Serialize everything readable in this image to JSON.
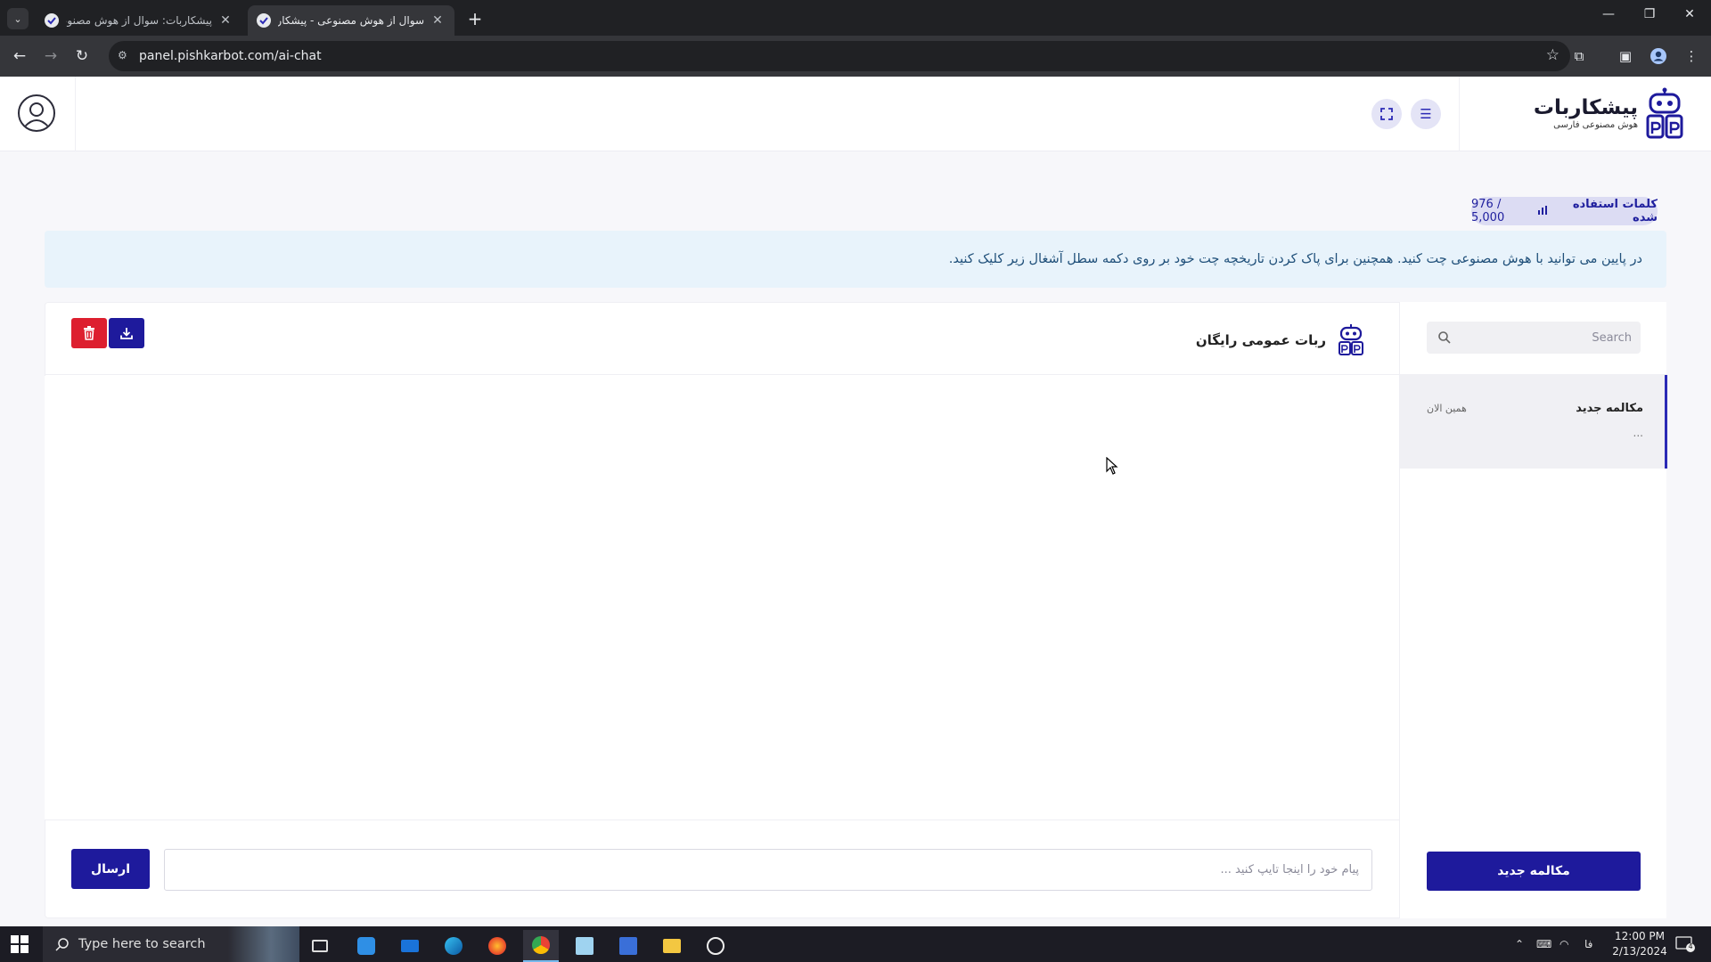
{
  "browser": {
    "tabs": [
      {
        "title": "پیشکاربات: سوال از هوش مصنوعی",
        "active": false
      },
      {
        "title": "سوال از هوش مصنوعی - پیشکاربات",
        "active": true
      }
    ],
    "url": "panel.pishkarbot.com/ai-chat"
  },
  "header": {
    "logo_title": "پیشکاربات",
    "logo_subtitle": "هوش مصنوعی فارسی"
  },
  "usage": {
    "label": "کلمات استفاده شده",
    "count": "976 / 5,000"
  },
  "info": {
    "text": "در پایین می توانید با هوش مصنوعی چت کنید. همچنین برای پاک کردن تاریخچه چت خود بر روی دکمه سطل آشغال زیر کلیک کنید."
  },
  "sidebar": {
    "search_placeholder": "Search",
    "conversations": [
      {
        "title": "مکالمه جدید",
        "time": "همین الان",
        "preview": "..."
      }
    ],
    "new_chat_label": "مکالمه جدید"
  },
  "chat": {
    "bot_name": "ربات عمومی رایگان",
    "input_placeholder": "پیام خود را اینجا تایپ کنید ...",
    "send_label": "ارسال"
  },
  "taskbar": {
    "search_text": "Type here to search",
    "time": "12:00 PM",
    "date": "2/13/2024",
    "lang": "فا",
    "notification_count": "4"
  },
  "colors": {
    "primary": "#1e1a9c",
    "danger": "#dd1f2f",
    "info_bg": "#e8f3fb"
  }
}
